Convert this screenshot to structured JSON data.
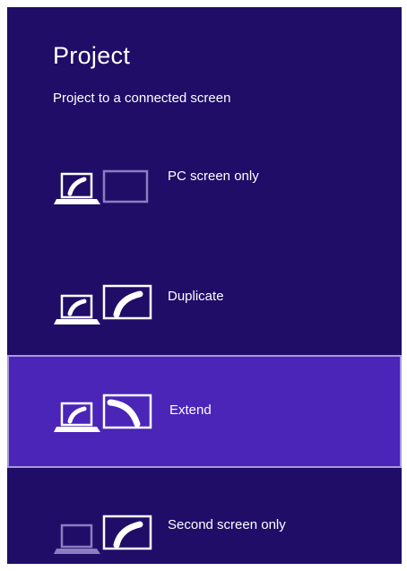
{
  "panel": {
    "title": "Project",
    "subtitle": "Project to a connected screen"
  },
  "options": [
    {
      "label": "PC screen only",
      "icon": "pc-screen-only-icon",
      "selected": false
    },
    {
      "label": "Duplicate",
      "icon": "duplicate-icon",
      "selected": false
    },
    {
      "label": "Extend",
      "icon": "extend-icon",
      "selected": true
    },
    {
      "label": "Second screen only",
      "icon": "second-screen-only-icon",
      "selected": false
    }
  ],
  "colors": {
    "background": "#1f0d68",
    "selected": "#4a25b8",
    "selected_border": "#a898e0",
    "foreground": "#ffffff",
    "dimmed": "#8a7ec0"
  }
}
